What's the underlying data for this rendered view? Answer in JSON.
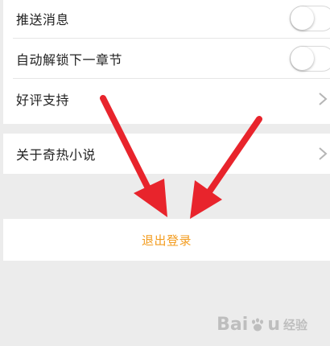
{
  "settings": {
    "push_label": "推送消息",
    "auto_unlock_label": "自动解锁下一章节",
    "rate_label": "好评支持",
    "about_label": "关于奇热小说",
    "push_enabled": false,
    "auto_unlock_enabled": false
  },
  "logout": {
    "label": "退出登录"
  },
  "colors": {
    "accent": "#f39c1f",
    "arrow": "#e8242c",
    "background": "#ececec"
  },
  "watermark": {
    "brand": "Bai",
    "brand_end": "u",
    "sub": "经验"
  }
}
